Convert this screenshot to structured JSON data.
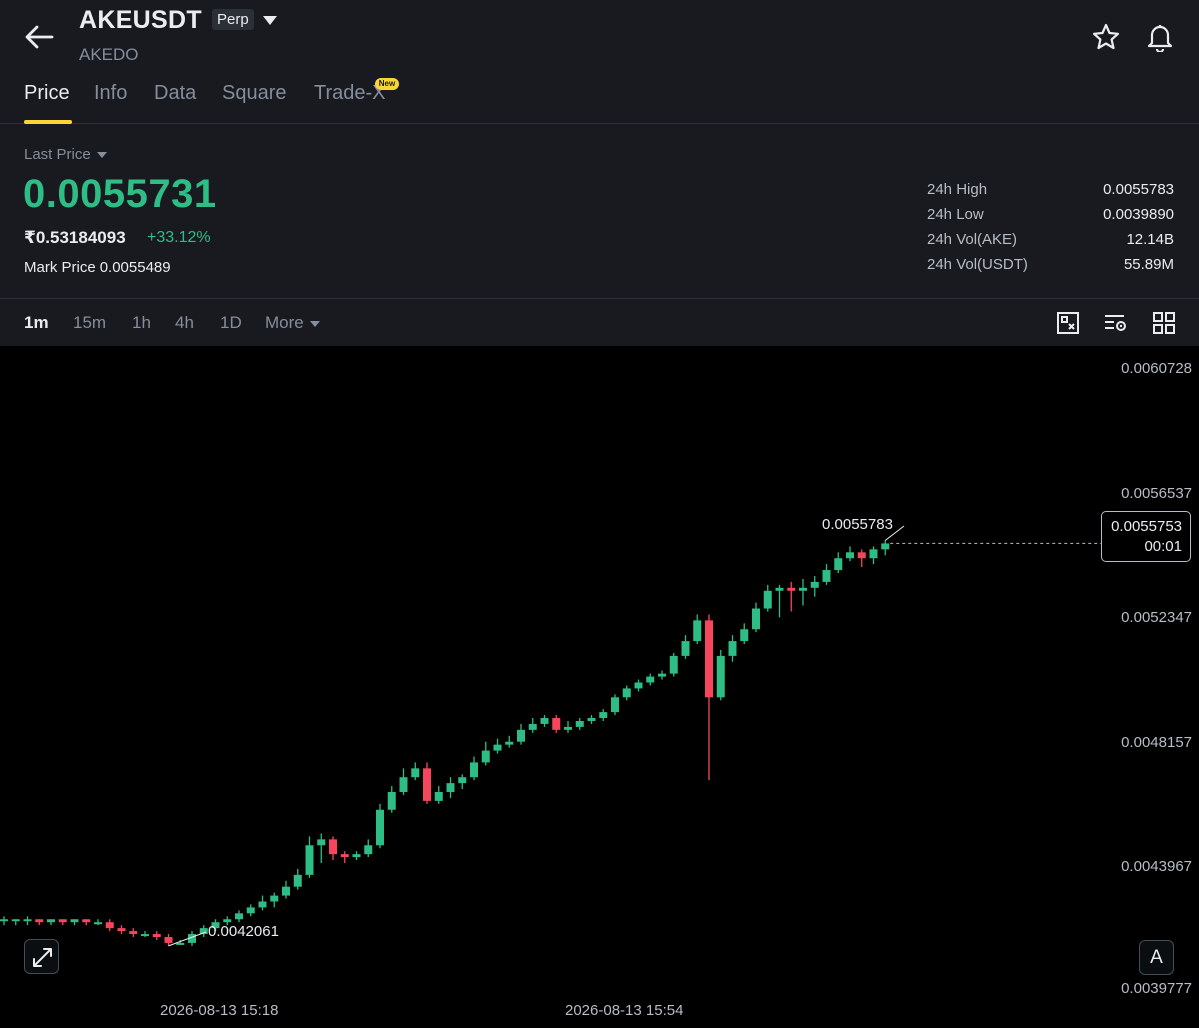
{
  "header": {
    "symbol": "AKEUSDT",
    "badge": "Perp",
    "subtitle": "AKEDO"
  },
  "tabs": [
    {
      "label": "Price",
      "active": true
    },
    {
      "label": "Info",
      "active": false
    },
    {
      "label": "Data",
      "active": false
    },
    {
      "label": "Square",
      "active": false
    },
    {
      "label": "Trade-X",
      "active": false,
      "badge": "New"
    }
  ],
  "ticker": {
    "last_price_label": "Last Price",
    "last_price": "0.0055731",
    "local_price": "₹0.53184093",
    "change_pct": "+33.12%",
    "mark_price_label": "Mark Price",
    "mark_price": "0.0055489"
  },
  "stats": [
    {
      "label": "24h High",
      "value": "0.0055783"
    },
    {
      "label": "24h Low",
      "value": "0.0039890"
    },
    {
      "label": "24h Vol(AKE)",
      "value": "12.14B"
    },
    {
      "label": "24h Vol(USDT)",
      "value": "55.89M"
    }
  ],
  "intervals": [
    {
      "label": "1m",
      "active": true
    },
    {
      "label": "15m",
      "active": false
    },
    {
      "label": "1h",
      "active": false
    },
    {
      "label": "4h",
      "active": false
    },
    {
      "label": "1D",
      "active": false
    },
    {
      "label": "More",
      "active": false
    }
  ],
  "toolbar_icons": [
    "chart-layout-icon",
    "indicator-settings-icon",
    "grid-view-icon"
  ],
  "colors": {
    "up": "#2ebd85",
    "down": "#f6465d",
    "accent": "#fcd535",
    "background": "#181a20",
    "chart_background": "#000000"
  },
  "chart": {
    "y_ticks": [
      "0.0060728",
      "0.0056537",
      "0.0052347",
      "0.0048157",
      "0.0043967",
      "0.0039777"
    ],
    "x_ticks": [
      "2026-08-13 15:18",
      "2026-08-13 15:54"
    ],
    "high_annotation": "0.0055783",
    "low_annotation": "0.0042061",
    "current_price_tag": "0.0055753",
    "countdown": "00:01",
    "auto_button": "A"
  },
  "chart_data": {
    "type": "candlestick",
    "interval": "1m",
    "ylim": [
      0.0039777,
      0.0060728
    ],
    "x_ticks": [
      "2026-08-13 15:18",
      "2026-08-13 15:54"
    ],
    "candles": [
      [
        0.00421,
        0.00421,
        0.00419,
        0.00422
      ],
      [
        0.00421,
        0.00421,
        0.00419,
        0.00421
      ],
      [
        0.00421,
        0.00421,
        0.00419,
        0.00422
      ],
      [
        0.00421,
        0.0042,
        0.00419,
        0.00421
      ],
      [
        0.0042,
        0.00421,
        0.00419,
        0.00421
      ],
      [
        0.00421,
        0.0042,
        0.00419,
        0.00421
      ],
      [
        0.0042,
        0.00421,
        0.00419,
        0.00421
      ],
      [
        0.00421,
        0.0042,
        0.00419,
        0.00421
      ],
      [
        0.0042,
        0.0042,
        0.00419,
        0.00421
      ],
      [
        0.0042,
        0.00418,
        0.00417,
        0.00421
      ],
      [
        0.00418,
        0.00417,
        0.00416,
        0.00419
      ],
      [
        0.00417,
        0.00416,
        0.00415,
        0.00418
      ],
      [
        0.00416,
        0.00416,
        0.00415,
        0.00417
      ],
      [
        0.00416,
        0.00415,
        0.00414,
        0.00417
      ],
      [
        0.00415,
        0.00413,
        0.00412,
        0.00416
      ],
      [
        0.00413,
        0.00413,
        0.00421,
        0.00414
      ],
      [
        0.00413,
        0.00416,
        0.00412,
        0.00417
      ],
      [
        0.00416,
        0.00418,
        0.00415,
        0.00419
      ],
      [
        0.00418,
        0.0042,
        0.00417,
        0.00421
      ],
      [
        0.0042,
        0.00421,
        0.00419,
        0.00422
      ],
      [
        0.00421,
        0.00423,
        0.0042,
        0.00424
      ],
      [
        0.00423,
        0.00425,
        0.00422,
        0.00426
      ],
      [
        0.00425,
        0.00427,
        0.00424,
        0.00429
      ],
      [
        0.00427,
        0.00429,
        0.00425,
        0.0043
      ],
      [
        0.00429,
        0.00432,
        0.00428,
        0.00434
      ],
      [
        0.00432,
        0.00436,
        0.00431,
        0.00438
      ],
      [
        0.00436,
        0.00446,
        0.00435,
        0.00449
      ],
      [
        0.00446,
        0.00448,
        0.0044,
        0.0045
      ],
      [
        0.00448,
        0.00443,
        0.00441,
        0.00449
      ],
      [
        0.00443,
        0.00442,
        0.0044,
        0.00444
      ],
      [
        0.00442,
        0.00443,
        0.00441,
        0.00444
      ],
      [
        0.00443,
        0.00446,
        0.00442,
        0.00448
      ],
      [
        0.00446,
        0.00458,
        0.00445,
        0.0046
      ],
      [
        0.00458,
        0.00464,
        0.00457,
        0.00466
      ],
      [
        0.00464,
        0.00469,
        0.00463,
        0.00472
      ],
      [
        0.00469,
        0.00472,
        0.00468,
        0.00474
      ],
      [
        0.00472,
        0.00461,
        0.0046,
        0.00474
      ],
      [
        0.00461,
        0.00464,
        0.0046,
        0.00466
      ],
      [
        0.00464,
        0.00467,
        0.00462,
        0.00469
      ],
      [
        0.00467,
        0.00469,
        0.00465,
        0.0047
      ],
      [
        0.00469,
        0.00474,
        0.00468,
        0.00476
      ],
      [
        0.00474,
        0.00478,
        0.00473,
        0.00481
      ],
      [
        0.00478,
        0.0048,
        0.00477,
        0.00482
      ],
      [
        0.0048,
        0.00481,
        0.00479,
        0.00483
      ],
      [
        0.00481,
        0.00485,
        0.0048,
        0.00487
      ],
      [
        0.00485,
        0.00487,
        0.00484,
        0.00489
      ],
      [
        0.00487,
        0.00489,
        0.00486,
        0.0049
      ],
      [
        0.00489,
        0.00485,
        0.00484,
        0.0049
      ],
      [
        0.00485,
        0.00486,
        0.00484,
        0.00488
      ],
      [
        0.00486,
        0.00488,
        0.00485,
        0.00489
      ],
      [
        0.00488,
        0.00489,
        0.00487,
        0.0049
      ],
      [
        0.00489,
        0.00491,
        0.00488,
        0.00492
      ],
      [
        0.00491,
        0.00496,
        0.0049,
        0.00497
      ],
      [
        0.00496,
        0.00499,
        0.00495,
        0.005
      ],
      [
        0.00499,
        0.00501,
        0.00498,
        0.00502
      ],
      [
        0.00501,
        0.00503,
        0.005,
        0.00504
      ],
      [
        0.00503,
        0.00504,
        0.00502,
        0.00505
      ],
      [
        0.00504,
        0.0051,
        0.00503,
        0.00511
      ],
      [
        0.0051,
        0.00515,
        0.00509,
        0.00517
      ],
      [
        0.00515,
        0.00522,
        0.00514,
        0.00524
      ],
      [
        0.00522,
        0.00496,
        0.00468,
        0.00524
      ],
      [
        0.00496,
        0.0051,
        0.00495,
        0.00512
      ],
      [
        0.0051,
        0.00515,
        0.00508,
        0.00517
      ],
      [
        0.00515,
        0.00519,
        0.00514,
        0.00521
      ],
      [
        0.00519,
        0.00526,
        0.00518,
        0.00528
      ],
      [
        0.00526,
        0.00532,
        0.00525,
        0.00534
      ],
      [
        0.00532,
        0.00533,
        0.00523,
        0.00534
      ],
      [
        0.00533,
        0.00532,
        0.00525,
        0.00535
      ],
      [
        0.00532,
        0.00533,
        0.00527,
        0.00536
      ],
      [
        0.00533,
        0.00535,
        0.0053,
        0.00537
      ],
      [
        0.00535,
        0.00539,
        0.00534,
        0.00541
      ],
      [
        0.00539,
        0.00543,
        0.00538,
        0.00545
      ],
      [
        0.00543,
        0.00545,
        0.00542,
        0.00547
      ],
      [
        0.00545,
        0.00543,
        0.0054,
        0.00546
      ],
      [
        0.00543,
        0.00546,
        0.00541,
        0.00547
      ],
      [
        0.00546,
        0.00548,
        0.00544,
        0.00549
      ]
    ]
  }
}
